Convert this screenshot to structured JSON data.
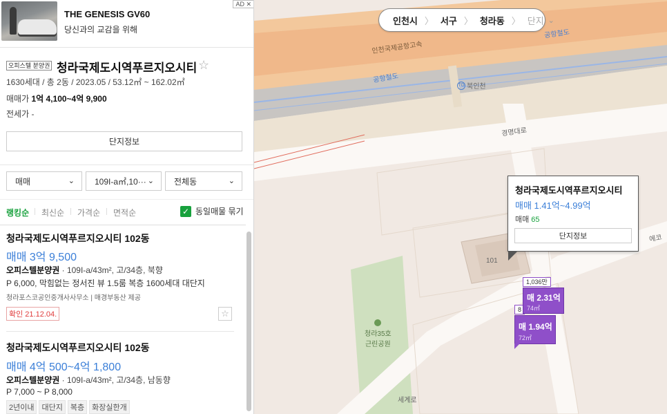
{
  "ad": {
    "badge": "AD ✕",
    "title": "THE GENESIS GV60",
    "subtitle": "당신과의 교감을 위해"
  },
  "complex": {
    "type_tag": "오피스텔 분양권",
    "name": "청라국제도시역푸르지오시티",
    "star": "☆",
    "meta": "1630세대 / 총 2동 / 2023.05 / 53.12㎡ ~ 162.02㎡",
    "sale_label": "매매가 ",
    "sale_value": "1억 4,100~4억 9,900",
    "jeonse": "전세가 -",
    "info_button": "단지정보"
  },
  "filters": {
    "deal": "매매",
    "area": "109I-a㎡,10···",
    "dong": "전체동",
    "chevron": "⌄"
  },
  "sort": {
    "options": [
      "랭킹순",
      "최신순",
      "가격순",
      "면적순"
    ],
    "same_listing": "동일매물 묶기",
    "check": "✓"
  },
  "listings": [
    {
      "title": "청라국제도시역푸르지오시티 102동",
      "price": "매매 3억 9,500",
      "type": "오피스텔분양권",
      "spec": " · 109I-a/43m², 고/34층, 북향",
      "desc": "P 6,000, 막힘없는 정서진 뷰 1.5룸 복층 1600세대 대단지",
      "agent": "청라포스코공인중개사사무소 | 매경부동산 제공",
      "confirm": "확인 21.12.04.",
      "star": "☆"
    },
    {
      "title": "청라국제도시역푸르지오시티 102동",
      "price": "매매 4억 500~4억 1,800",
      "type": "오피스텔분양권",
      "spec": " · 109I-a/43m², 고/34층, 남동향",
      "desc": "P 7,000 ~ P 8,000",
      "tags": [
        "2년이내",
        "대단지",
        "복층",
        "화장실한개"
      ]
    }
  ],
  "map": {
    "breadcrumb": {
      "city": "인천시",
      "district": "서구",
      "dong": "청라동",
      "complex": "단지",
      "sep": "〉",
      "chevron": "⌄"
    },
    "labels": {
      "highway": "인천국제공항고속",
      "rail1": "공항철도",
      "rail2": "공항철도",
      "station": "북인천",
      "station_badge": "TG",
      "road1": "경명대로",
      "road2": "세계로",
      "park": "청라35호\n근린공원",
      "park_line1": "청라35호",
      "park_line2": "근린공원",
      "bldg": "101",
      "edge": "에코"
    },
    "popup": {
      "name": "청라국제도시역푸르지오시티",
      "range": "매매 1.41억~4.99억",
      "count_label": "매매 ",
      "count": "65",
      "button": "단지정보"
    },
    "markers": [
      {
        "top": "1,036만",
        "price": "매 2.31억",
        "area": "74㎡"
      },
      {
        "top": "8",
        "price": "매 1.94억",
        "area": "72㎡"
      }
    ]
  }
}
